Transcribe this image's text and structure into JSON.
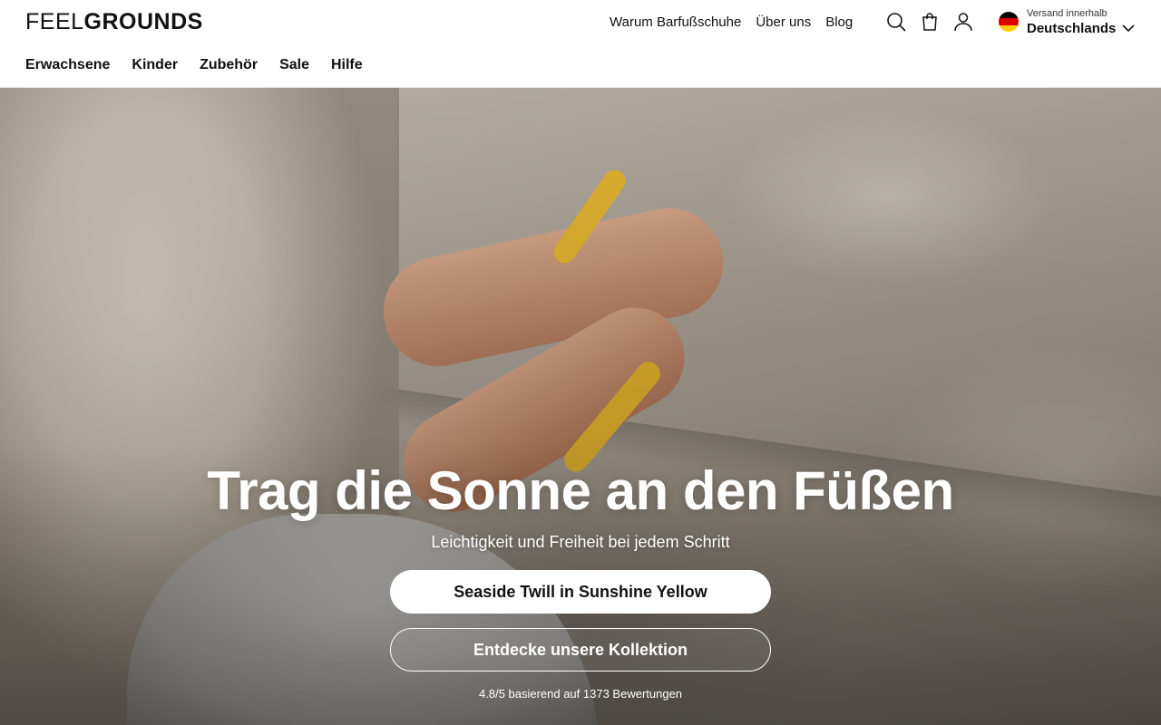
{
  "brand": {
    "logo_light": "FEEL",
    "logo_bold": "GROUNDS"
  },
  "topnav": {
    "items": [
      "Warum Barfußschuhe",
      "Über uns",
      "Blog"
    ]
  },
  "icons": {
    "search": "search-icon",
    "cart": "shopping-bag-icon",
    "account": "user-icon",
    "chevron": "chevron-down-icon"
  },
  "shipping": {
    "label": "Versand innerhalb",
    "country": "Deutschlands",
    "flag_colors": [
      "#000000",
      "#dd0000",
      "#ffce00"
    ]
  },
  "mainnav": {
    "items": [
      "Erwachsene",
      "Kinder",
      "Zubehör",
      "Sale",
      "Hilfe"
    ]
  },
  "hero": {
    "title": "Trag die Sonne an den Füßen",
    "subtitle": "Leichtigkeit und Freiheit bei jedem Schritt",
    "primary_cta": "Seaside Twill in Sunshine Yellow",
    "secondary_cta": "Entdecke unsere Kollektion",
    "rating": "4.8/5 basierend auf 1373 Bewertungen"
  }
}
